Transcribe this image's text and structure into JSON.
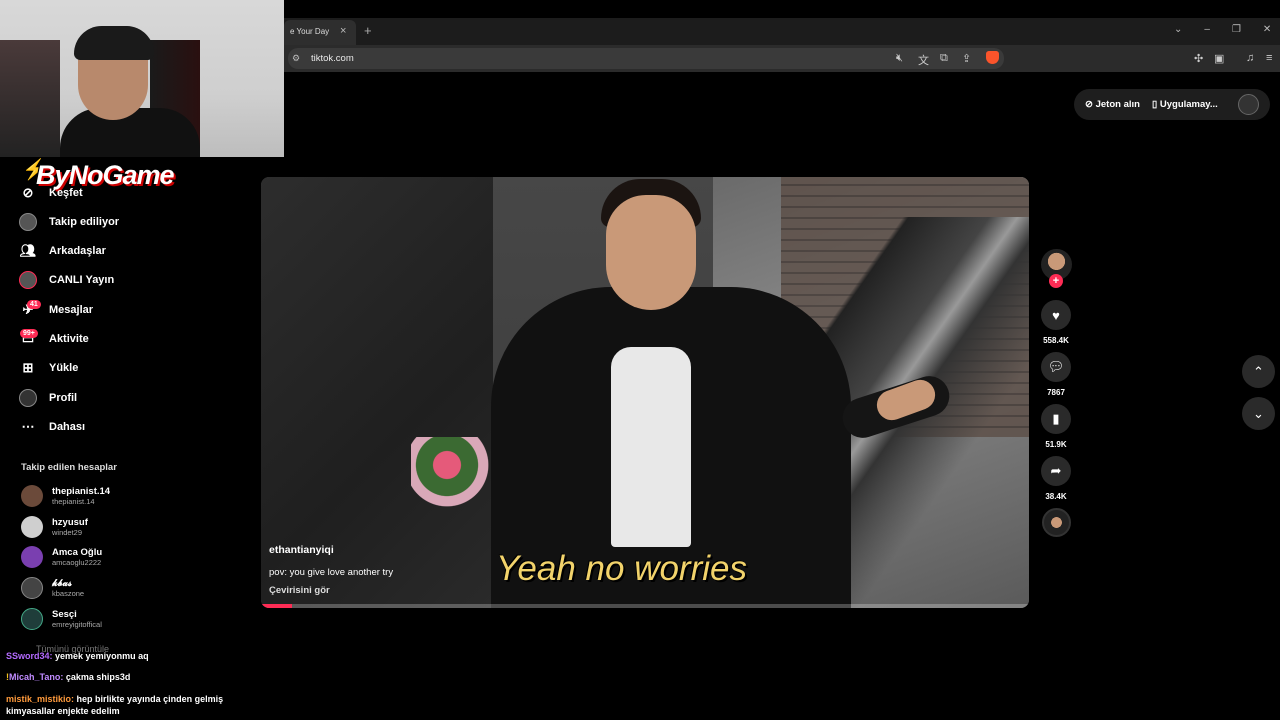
{
  "browser": {
    "tab_title": "e Your Day",
    "tab_close": "×",
    "new_tab": "+",
    "url": "tiktok.com",
    "window_controls": [
      "⌄",
      "–",
      "❐",
      "✕"
    ],
    "toolbar_icons": [
      "mute-icon",
      "translate-icon",
      "open-external-icon",
      "share-icon",
      "brave-shields-icon",
      "extensions-icon",
      "wallet-icon",
      "media-icon",
      "menu-icon"
    ]
  },
  "overlay": {
    "logo_text": "ByNoGame"
  },
  "sidebar": {
    "items": [
      {
        "label": "Keşfet",
        "icon": "compass-icon"
      },
      {
        "label": "Takip ediliyor",
        "icon": "following-avatar-icon"
      },
      {
        "label": "Arkadaşlar",
        "icon": "friends-icon"
      },
      {
        "label": "CANLI Yayın",
        "icon": "live-icon"
      },
      {
        "label": "Mesajlar",
        "icon": "messages-icon",
        "badge": "41"
      },
      {
        "label": "Aktivite",
        "icon": "activity-icon",
        "badge": "99+"
      },
      {
        "label": "Yükle",
        "icon": "upload-icon"
      },
      {
        "label": "Profil",
        "icon": "profile-icon"
      },
      {
        "label": "Dahası",
        "icon": "more-icon"
      }
    ],
    "following_header": "Takip edilen hesaplar",
    "accounts": [
      {
        "name": "thepianist.14",
        "handle": "thepianist.14",
        "color": "#6b4a3a"
      },
      {
        "name": "hzyusuf",
        "handle": "windet29",
        "color": "#cfcfcf"
      },
      {
        "name": "Amca Oğlu",
        "handle": "amcaoglu2222",
        "color": "#7a3fb0"
      },
      {
        "name": "𝓴𝓫𝓪𝓼",
        "handle": "kbaszone",
        "color": "#444"
      },
      {
        "name": "Sesçi",
        "handle": "emreyigitoffical",
        "color": "#1f3d3a"
      }
    ],
    "see_all": "Tümünü görüntüle"
  },
  "chat": [
    {
      "user": "SSword34:",
      "message": "yemek yemiyonmu aq",
      "color": "#b46bff"
    },
    {
      "user": "Micah_Tano:",
      "message": "çakma ships3d",
      "color": "#c08bff",
      "badge": "!"
    },
    {
      "user": "mistik_mistikio:",
      "message": "hep birlikte yayında çinden gelmiş kimyasallar enjekte edelim",
      "color": "#ff9a3c"
    }
  ],
  "topright": {
    "coins_label": "Jeton alın",
    "app_label": "Uygulamay..."
  },
  "video": {
    "caption_overlay": "Yeah no worries",
    "username": "ethantianyiqi",
    "description": "pov: you give love another try",
    "translate": "Çevirisini gör",
    "progress": 0.04
  },
  "actions": {
    "follow_plus": "+",
    "likes": "558.4K",
    "comments": "7867",
    "saves": "51.9K",
    "shares": "38.4K"
  },
  "nav_arrows": {
    "up": "⌃",
    "down": "⌄"
  }
}
